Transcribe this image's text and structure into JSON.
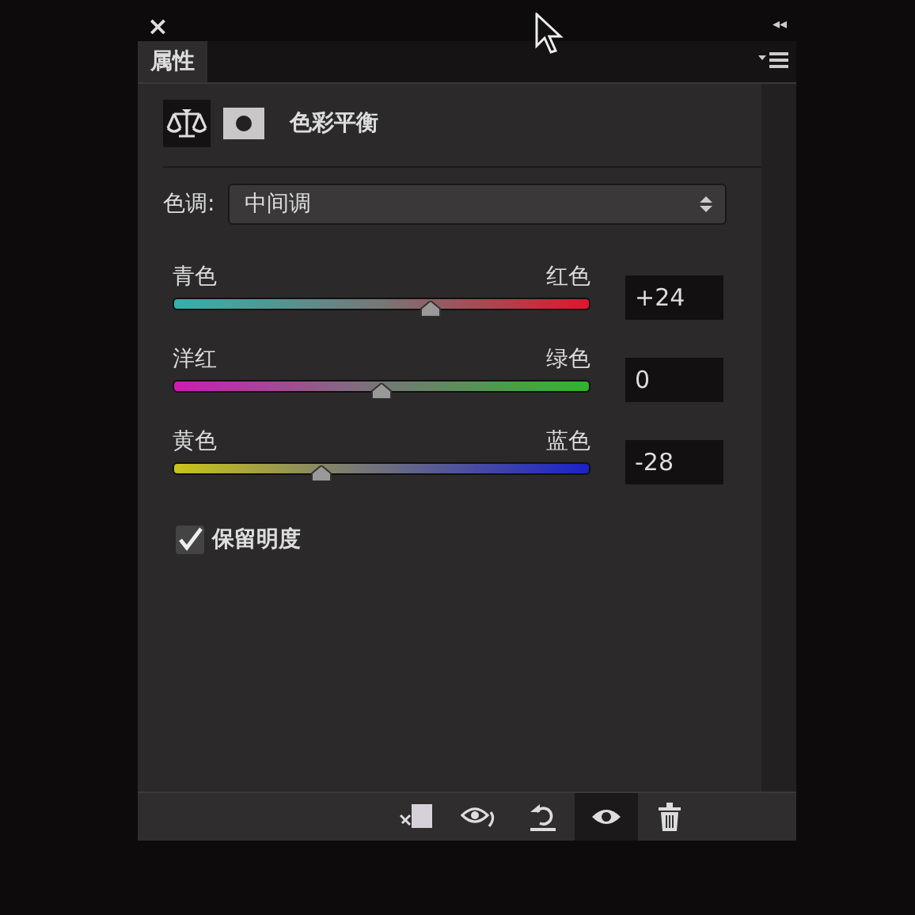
{
  "panel": {
    "close": "×",
    "collapse": "◂◂",
    "tab": {
      "label": "属性",
      "selected": true
    }
  },
  "header": {
    "title": "色彩平衡"
  },
  "tone": {
    "label": "色调:",
    "value": "中间调"
  },
  "sliders": [
    {
      "kind": "cyanred",
      "left": "青色",
      "right": "红色",
      "level": 0.62,
      "reading": "+24"
    },
    {
      "kind": "magentagreen",
      "left": "洋红",
      "right": "绿色",
      "level": 0.5,
      "reading": "0"
    },
    {
      "kind": "yellowblue",
      "left": "黄色",
      "right": "蓝色",
      "level": 0.355,
      "reading": "-28"
    }
  ],
  "preserve": {
    "label": "保留明度",
    "checked": true
  },
  "toolbar": [
    {
      "kind": "clip",
      "selected": false
    },
    {
      "kind": "preview",
      "selected": false
    },
    {
      "kind": "reset",
      "selected": false
    },
    {
      "kind": "visibility",
      "selected": true
    },
    {
      "kind": "delete",
      "selected": false
    }
  ]
}
